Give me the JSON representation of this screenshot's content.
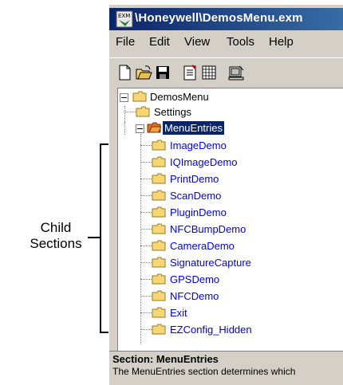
{
  "annotation": {
    "line1": "Child",
    "line2": "Sections"
  },
  "window": {
    "title": "\\Honeywell\\DemosMenu.exm"
  },
  "menu": [
    "File",
    "Edit",
    "View",
    "Tools",
    "Help"
  ],
  "toolbar": [
    "new-icon",
    "open-icon",
    "save-icon",
    "properties-icon",
    "grid-icon",
    "export-icon"
  ],
  "tree": {
    "root": "DemosMenu",
    "settings": "Settings",
    "selected": "MenuEntries",
    "children": [
      "ImageDemo",
      "IQImageDemo",
      "PrintDemo",
      "ScanDemo",
      "PluginDemo",
      "NFCBumpDemo",
      "CameraDemo",
      "SignatureCapture",
      "GPSDemo",
      "NFCDemo",
      "Exit",
      "EZConfig_Hidden"
    ]
  },
  "description": {
    "title": "Section: MenuEntries",
    "text": "The MenuEntries section determines which"
  },
  "colors": {
    "titlebar": "#0a246a",
    "link": "#0000ee",
    "selection": "#0a246a",
    "folder": "#f7d774"
  }
}
